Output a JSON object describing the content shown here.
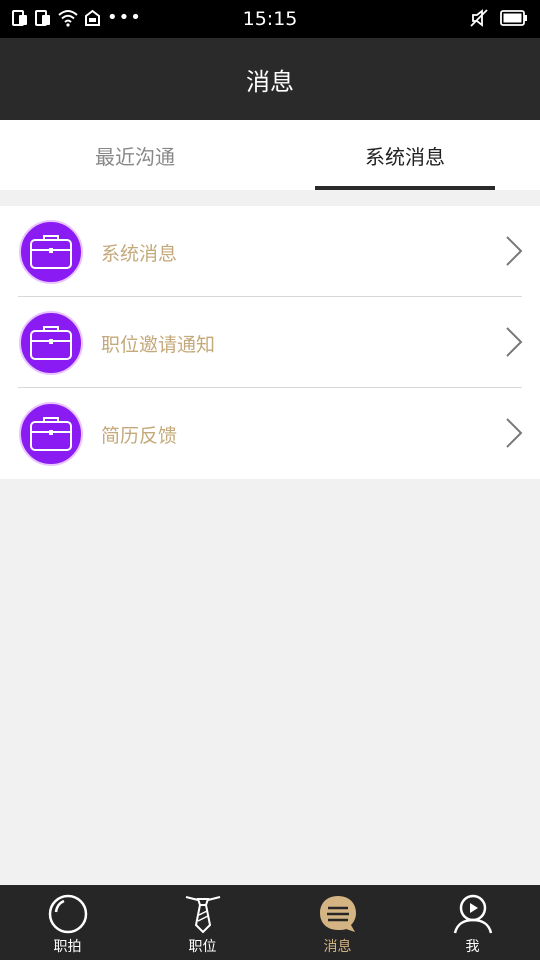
{
  "status_bar": {
    "time": "15:15",
    "dots": "•••"
  },
  "header": {
    "title": "消息"
  },
  "tabs": [
    {
      "label": "最近沟通",
      "active": false
    },
    {
      "label": "系统消息",
      "active": true
    }
  ],
  "list": [
    {
      "label": "系统消息",
      "icon": "briefcase-icon"
    },
    {
      "label": "职位邀请通知",
      "icon": "briefcase-icon"
    },
    {
      "label": "简历反馈",
      "icon": "briefcase-icon"
    }
  ],
  "tabbar": [
    {
      "label": "职拍",
      "icon": "camera-lens-icon",
      "active": false
    },
    {
      "label": "职位",
      "icon": "tie-icon",
      "active": false
    },
    {
      "label": "消息",
      "icon": "chat-bubble-icon",
      "active": true
    },
    {
      "label": "我",
      "icon": "profile-icon",
      "active": false
    }
  ],
  "colors": {
    "accent": "#d4b483",
    "avatar": "#8a1bf3",
    "nav": "#2a2a2a",
    "row_text": "#c4a97a"
  }
}
